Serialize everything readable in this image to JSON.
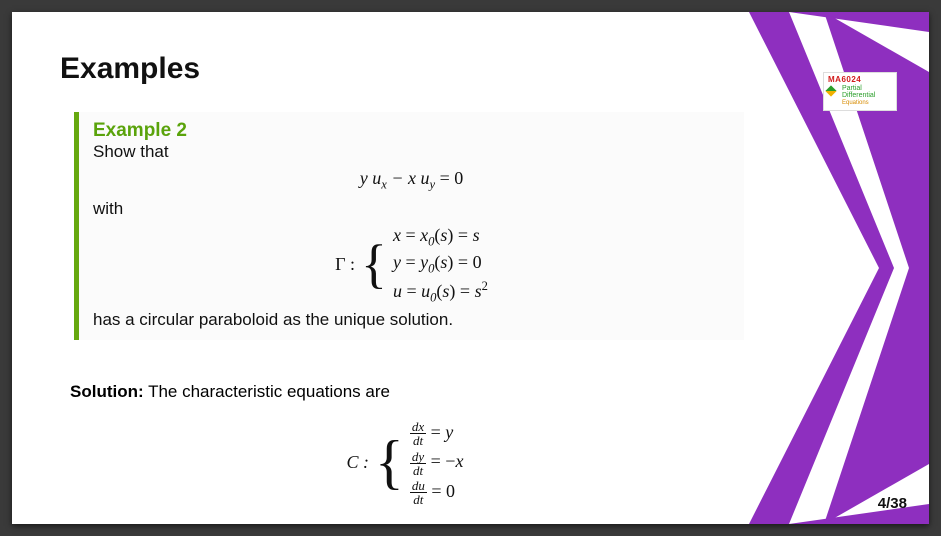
{
  "slide": {
    "title": "Examples",
    "example_heading": "Example 2",
    "show_that": "Show that",
    "pde": "y u_x − x u_y = 0",
    "with": "with",
    "gamma_label": "Γ :",
    "gamma_lines": {
      "l1": "x = x₀(s) = s",
      "l2": "y = y₀(s) = 0",
      "l3": "u = u₀(s) = s²"
    },
    "conclusion": "has a circular paraboloid as the unique solution.",
    "solution_label": "Solution:",
    "solution_text": " The characteristic equations are",
    "char_label": "C :",
    "char_lines": {
      "l1_lhs_num": "dx",
      "l1_lhs_den": "dt",
      "l1_rhs": "= y",
      "l2_lhs_num": "dy",
      "l2_lhs_den": "dt",
      "l2_rhs": "= −x",
      "l3_lhs_num": "du",
      "l3_lhs_den": "dt",
      "l3_rhs": "= 0"
    },
    "page": "4/38"
  },
  "badge": {
    "code": "MA6024",
    "p1": "Partial",
    "p2": "Differential",
    "p3": "Equations"
  }
}
